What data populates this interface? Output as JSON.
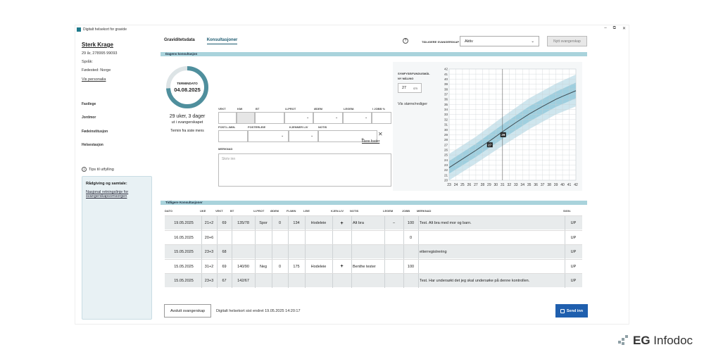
{
  "window": {
    "title": "Digitalt helsekort for gravide",
    "controls": [
      "–",
      "⧉",
      "✕"
    ]
  },
  "patient": {
    "name": "Sterk Krage",
    "age_id": "29 år, 278995 99093",
    "language": "Språk:",
    "birthplace": "Fødested: Norge",
    "link": "Vis personalia"
  },
  "sidebar": {
    "items": [
      {
        "label": "Fastlege"
      },
      {
        "label": "Jordmor"
      },
      {
        "label": "Fødeinstitusjon"
      },
      {
        "label": "Helsestasjon"
      }
    ]
  },
  "tips": {
    "label": "Tips til utfylling",
    "box_title": "Rådgiving og samtale:",
    "box_link": "Nasjonal retningslinje for svangerskapsomsorgen"
  },
  "tabs": [
    {
      "label": "Graviditetsdata"
    },
    {
      "label": "Konsultasjoner",
      "active": true
    }
  ],
  "header": {
    "prev_label": "TIDLIGERE SVANGERSKAP",
    "prev_value": "Aktiv",
    "new_button": "Nytt svangerskap"
  },
  "today": {
    "section": "Dagens konsultasjon",
    "termin_label": "TERMINDATO",
    "termin_date": "04.08.2025",
    "weeks": "29 uker, 3 dager",
    "weeks_sub": "ut i svangerskapet",
    "termin_source": "Termin fra siste mens",
    "progress_fraction": 0.74
  },
  "fields": {
    "row1": [
      "VEKT",
      "KMI",
      "BT",
      "U-PROT",
      "ØDEM",
      "LEGEM.",
      "I JOBB %"
    ],
    "row2": [
      "FOST.L./MIN.",
      "FOSTERLEIE",
      "KJENNER LIV",
      "NOTIS"
    ],
    "flere": "Flere foster",
    "merknad_label": "MERKNAD",
    "merknad_placeholder": "Skriv inn"
  },
  "symfyse": {
    "title": "SYMFYSE/FUNDUSMÅL",
    "ny_label": "NY MÅLING",
    "value": "27",
    "unit": "cm",
    "vis": "Vis større/rediger"
  },
  "chart_data": {
    "type": "line",
    "x_ticks": [
      23,
      24,
      25,
      26,
      27,
      28,
      29,
      30,
      31,
      32,
      33,
      34,
      35,
      36,
      37,
      38,
      39,
      40,
      41,
      42
    ],
    "y_ticks": [
      20,
      21,
      22,
      23,
      24,
      25,
      26,
      27,
      28,
      29,
      30,
      31,
      32,
      33,
      34,
      35,
      36,
      37,
      38,
      39,
      40,
      41,
      42
    ],
    "xlim": [
      23,
      42
    ],
    "ylim": [
      20,
      42
    ],
    "median": [
      [
        23,
        22.5
      ],
      [
        25,
        24.2
      ],
      [
        27,
        25.9
      ],
      [
        29,
        27.7
      ],
      [
        31,
        29.6
      ],
      [
        33,
        31.4
      ],
      [
        35,
        33.1
      ],
      [
        37,
        34.6
      ],
      [
        39,
        36
      ],
      [
        40,
        36.6
      ],
      [
        42,
        37.7
      ]
    ],
    "band_inner": [
      [
        23,
        21.3,
        23.8
      ],
      [
        27,
        24.6,
        27.2
      ],
      [
        31,
        28.2,
        31.0
      ],
      [
        35,
        31.6,
        34.6
      ],
      [
        39,
        34.5,
        37.5
      ],
      [
        42,
        36.2,
        39.3
      ]
    ],
    "band_outer": [
      [
        23,
        20.0,
        25.2
      ],
      [
        27,
        23.3,
        28.6
      ],
      [
        31,
        26.8,
        32.5
      ],
      [
        35,
        30.1,
        36.2
      ],
      [
        39,
        33.0,
        39.1
      ],
      [
        42,
        34.6,
        40.9
      ]
    ],
    "points": [
      {
        "x": 29.1,
        "y": 27,
        "label": "27"
      },
      {
        "x": 31.1,
        "y": 29,
        "label": "29"
      }
    ],
    "ref_x": 31,
    "colors": {
      "outer": "#cfe6ee",
      "inner": "#9fcfdf",
      "line": "#3d4b52",
      "grid": "#c9d0d3"
    }
  },
  "history": {
    "section": "Tidligere Konsultasjoner",
    "headers": [
      "DATO",
      "UKE",
      "VEKT",
      "BT",
      "U-PROT",
      "ØDEM",
      "FL/MIN",
      "LEIE",
      "KJEN.LIV",
      "NOTIS",
      "LEGEM",
      "JOBB",
      "MERKNAD",
      "SIGN."
    ],
    "rows": [
      [
        "19.05.2025",
        "21+2",
        "69",
        "135/78",
        "Spor",
        "0",
        "134",
        "Hodeleie",
        "+",
        "Alt bra",
        "–",
        "100",
        "Test. Alt bra med mor og barn.",
        "UP"
      ],
      [
        "16.05.2025",
        "20+6",
        "",
        "",
        "",
        "",
        "",
        "",
        "",
        "",
        "",
        "0",
        "",
        "UP"
      ],
      [
        "15.05.2025",
        "23+3",
        "68",
        "",
        "",
        "",
        "",
        "",
        "",
        "",
        "",
        "",
        "etterregistrering",
        "UP"
      ],
      [
        "15.05.2025",
        "31+2",
        "69",
        "140/90",
        "Neg",
        "0",
        "175",
        "Hodeleie",
        "+",
        "Benthe tester",
        "",
        "100",
        "",
        "UP"
      ],
      [
        "15.05.2025",
        "23+3",
        "67",
        "142/67",
        "",
        "",
        "",
        "",
        "",
        "",
        "",
        "",
        "Test. Har undersøkt det jeg skal undersøke på denne kontrollen.",
        "UP"
      ]
    ]
  },
  "footer": {
    "end_button": "Avslutt svangerskap",
    "status": "Digitalt helsekort sist endret 19.05.2025 14:20:17",
    "send": "Send inn"
  },
  "brand": {
    "name_bold": "EG",
    "name": "Infodoc"
  }
}
